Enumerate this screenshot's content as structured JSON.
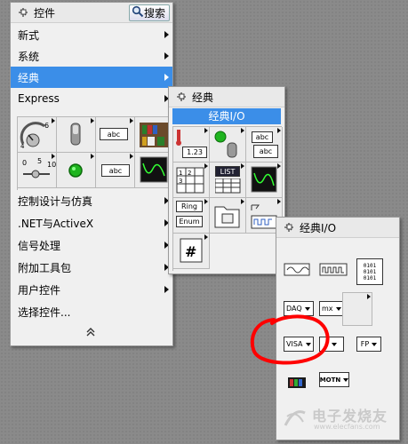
{
  "main_palette": {
    "title": "控件",
    "search_label": "搜索",
    "items": [
      {
        "label": "新式"
      },
      {
        "label": "系统"
      },
      {
        "label": "经典"
      },
      {
        "label": "Express"
      }
    ],
    "icon_row_1": [
      "numeric-controls-icon",
      "boolean-icon",
      "string-path-icon",
      "array-cluster-icon"
    ],
    "icon_row_2": [
      "numeric-slider-icon",
      "led-icon",
      "string-control-icon",
      "graph-icon"
    ],
    "lower_items": [
      {
        "label": "控制设计与仿真"
      },
      {
        "label": ".NET与ActiveX"
      },
      {
        "label": "信号处理"
      },
      {
        "label": "附加工具包"
      },
      {
        "label": "用户控件"
      },
      {
        "label": "选择控件..."
      }
    ]
  },
  "classic_palette": {
    "title": "经典",
    "header": "经典I/O",
    "cells": {
      "numeric": "1.23",
      "string_abc": "abc",
      "list": "LIST",
      "ring": "Ring",
      "enum": "Enum"
    }
  },
  "classic_io_palette": {
    "title": "经典I/O",
    "cells": {
      "binary": "0101",
      "daq": "DAQ",
      "mx": "mx",
      "visa": "VISA",
      "ivi": "I",
      "fp": "FP",
      "motn": "MOTN"
    }
  },
  "annotation": {
    "color": "#ff0000"
  },
  "watermark": {
    "text": "电子发烧友",
    "url": "www.elecfans.com"
  }
}
